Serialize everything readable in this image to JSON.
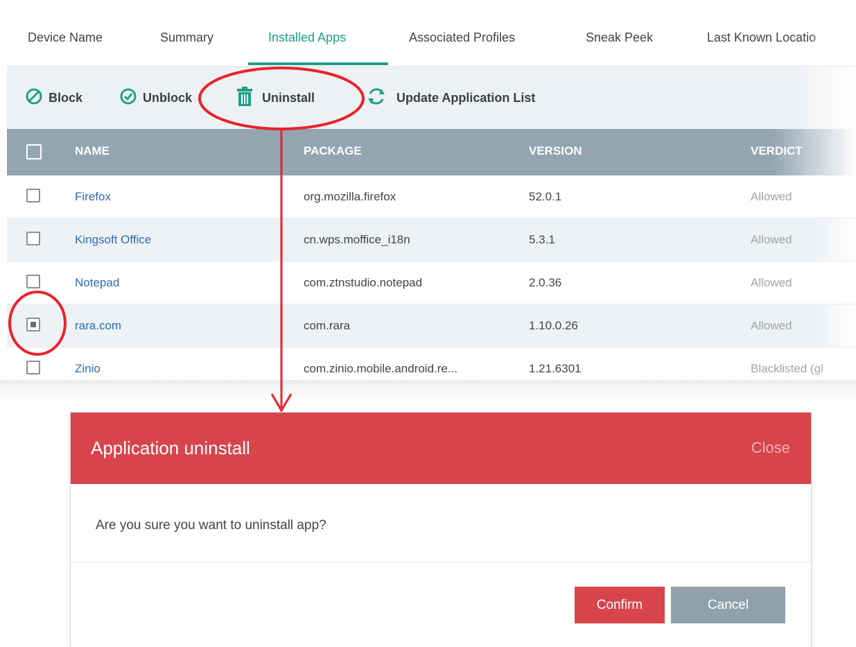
{
  "tabs": [
    {
      "label": "Device Name"
    },
    {
      "label": "Summary"
    },
    {
      "label": "Installed Apps",
      "active": true
    },
    {
      "label": "Associated Profiles"
    },
    {
      "label": "Sneak Peek"
    },
    {
      "label": "Last Known Locatio"
    }
  ],
  "toolbar": {
    "block": {
      "label": "Block",
      "icon": "block-icon"
    },
    "unblock": {
      "label": "Unblock",
      "icon": "check-circle-icon"
    },
    "uninstall": {
      "label": "Uninstall",
      "icon": "trash-icon"
    },
    "update": {
      "label": "Update Application List",
      "icon": "refresh-icon"
    }
  },
  "table": {
    "headers": {
      "name": "NAME",
      "package": "PACKAGE",
      "version": "VERSION",
      "verdict": "VERDICT"
    },
    "rows": [
      {
        "name": "Firefox",
        "package": "org.mozilla.firefox",
        "version": "52.0.1",
        "verdict": "Allowed",
        "checked": false
      },
      {
        "name": "Kingsoft Office",
        "package": "cn.wps.moffice_i18n",
        "version": "5.3.1",
        "verdict": "Allowed",
        "checked": false
      },
      {
        "name": "Notepad",
        "package": "com.ztnstudio.notepad",
        "version": "2.0.36",
        "verdict": "Allowed",
        "checked": false
      },
      {
        "name": "rara.com",
        "package": "com.rara",
        "version": "1.10.0.26",
        "verdict": "Allowed",
        "checked": true
      },
      {
        "name": "Zinio",
        "package": "com.zinio.mobile.android.re...",
        "version": "1.21.6301",
        "verdict": "Blacklisted (gl",
        "checked": false
      }
    ]
  },
  "dialog": {
    "title": "Application uninstall",
    "close_label": "Close",
    "message": "Are you sure you want to uninstall app?",
    "confirm_label": "Confirm",
    "cancel_label": "Cancel"
  },
  "colors": {
    "accent": "#1ea08a",
    "link": "#2d6bb5",
    "dialog_header": "#d7454b",
    "cancel_button": "#8fa1ad",
    "table_header": "#93a5b1",
    "annotation": "#e8232a"
  }
}
